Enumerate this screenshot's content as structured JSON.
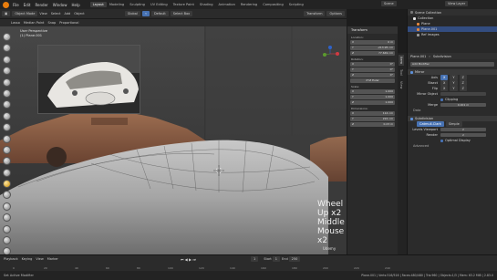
{
  "menubar": {
    "menus": [
      "File",
      "Edit",
      "Render",
      "Window",
      "Help"
    ],
    "workspaces": [
      "Layout",
      "Modeling",
      "Sculpting",
      "UV Editing",
      "Texture Paint",
      "Shading",
      "Animation",
      "Rendering",
      "Compositing",
      "Scripting"
    ],
    "active_workspace": "Layout",
    "scene": "Scene",
    "view_layer": "View Layer"
  },
  "header2": {
    "mode": "Object Mode",
    "menus": [
      "View",
      "Select",
      "Add",
      "Object"
    ],
    "orientation": "Global",
    "pivot": "Default",
    "drag": "Select Box",
    "transform_label": "Transform",
    "options_label": "Options"
  },
  "header3": {
    "items": [
      "Lasso",
      "Median Point",
      "Snap",
      "Proportional"
    ]
  },
  "viewport": {
    "view_name": "User Perspective",
    "collection_object": "(1) Plane.001",
    "overlay_line1": "Wheel Up x2",
    "overlay_line2": "Middle Mouse x2",
    "watermark": "Udemy"
  },
  "npanel": {
    "header": "Transform",
    "location_label": "Location:",
    "location": [
      [
        "X",
        "0 m"
      ],
      [
        "Y",
        "-213.95 cm"
      ],
      [
        "Z",
        "77.649 cm"
      ]
    ],
    "rotation_label": "Rotation:",
    "rotation": [
      [
        "X",
        "0°"
      ],
      [
        "Y",
        "0°"
      ],
      [
        "Z",
        "0°"
      ]
    ],
    "mode": "XYZ Euler",
    "scale_label": "Scale:",
    "scale": [
      [
        "X",
        "1.000"
      ],
      [
        "Y",
        "1.000"
      ],
      [
        "Z",
        "1.000"
      ]
    ],
    "dimensions_label": "Dimensions:",
    "dimensions": [
      [
        "X",
        "114 cm"
      ],
      [
        "Y",
        "222 cm"
      ],
      [
        "Z",
        "0.23 m"
      ]
    ],
    "tabs": [
      "Item",
      "Tool",
      "View"
    ]
  },
  "outliner": {
    "title": "Scene Collection",
    "rows": [
      "Collection",
      "Plane",
      "Plane.001",
      "Ref Images"
    ]
  },
  "properties": {
    "object": "Plane.001",
    "modifier_tab": "Subdivision",
    "add_modifier": "Add Modifier",
    "mirror": {
      "name": "Mirror",
      "axis_label": "Axis",
      "bisect_label": "Bisect",
      "flip_label": "Flip",
      "axes": [
        "X",
        "Y",
        "Z"
      ],
      "mirror_object": "Mirror Object",
      "clipping": "Clipping",
      "merge_label": "Merge",
      "merge_value": "0.001 m",
      "data_label": "Data"
    },
    "subsurf": {
      "name": "Subdivision",
      "catmull": "Catmull-Clark",
      "simple": "Simple",
      "levels_viewport_label": "Levels Viewport",
      "levels_viewport": "2",
      "render_label": "Render",
      "render": "2",
      "optimal": "Optimal Display",
      "advanced": "Advanced"
    }
  },
  "timeline": {
    "menus": [
      "Playback",
      "Keying",
      "View",
      "Marker"
    ],
    "frame": "1",
    "start_label": "Start",
    "start": "1",
    "end_label": "End",
    "end": "250",
    "ticks": [
      "0",
      "20",
      "40",
      "60",
      "80",
      "100",
      "120",
      "140",
      "160",
      "180",
      "200",
      "220",
      "240"
    ]
  },
  "statusbar": {
    "left": "Set Active Modifier",
    "right": "Plane.001 | Verts:516/516 | Faces:480/480 | Tris:960 | Objects:1/3 | Mem: 63.2 MiB | 2.83.0"
  },
  "colors": {
    "accent": "#4772b3",
    "active_tool": "#d8a530",
    "car_brown": "#8c5e44",
    "car_silver": "#b9b9b9"
  }
}
